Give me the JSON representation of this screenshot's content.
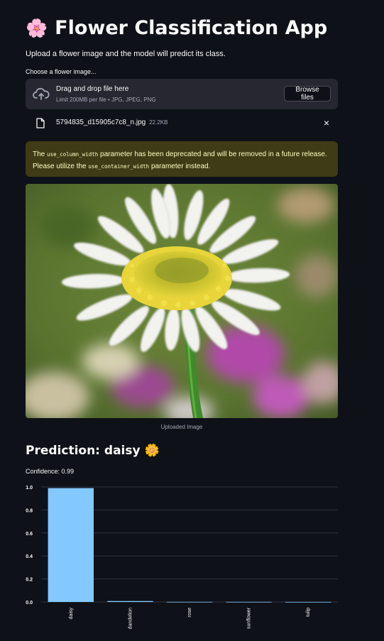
{
  "header": {
    "title": "Flower Classification App",
    "title_icon": "cherry-blossom-icon",
    "subtitle": "Upload a flower image and the model will predict its class."
  },
  "uploader": {
    "label": "Choose a flower image...",
    "drop_title": "Drag and drop file here",
    "limit": "Limit 200MB per file • JPG, JPEG, PNG",
    "browse_label": "Browse files"
  },
  "file": {
    "name": "5794835_d15905c7c8_n.jpg",
    "size": "22.2KB",
    "close": "×"
  },
  "warning": {
    "part1": "The ",
    "code1": "use_column_width",
    "part2": " parameter has been deprecated and will be removed in a future release. Please utilize the ",
    "code2": "use_container_width",
    "part3": " parameter instead."
  },
  "image": {
    "caption": "Uploaded Image"
  },
  "prediction": {
    "label": "Prediction: daisy",
    "icon": "daisy-icon",
    "confidence": "Confidence: 0.99"
  },
  "colors": {
    "background": "#0e1117",
    "bar": "#83c9ff",
    "warning_bg": "#3e3b16",
    "warning_text": "#ffffc2"
  },
  "chart_data": {
    "type": "bar",
    "categories": [
      "daisy",
      "dandelion",
      "rose",
      "sunflower",
      "tulip"
    ],
    "values": [
      0.99,
      0.008,
      0.001,
      0.001,
      0.0005
    ],
    "ylim": [
      0,
      1.0
    ],
    "yticks": [
      "0.0",
      "0.2",
      "0.4",
      "0.6",
      "0.8",
      "1.0"
    ],
    "grid": true
  }
}
